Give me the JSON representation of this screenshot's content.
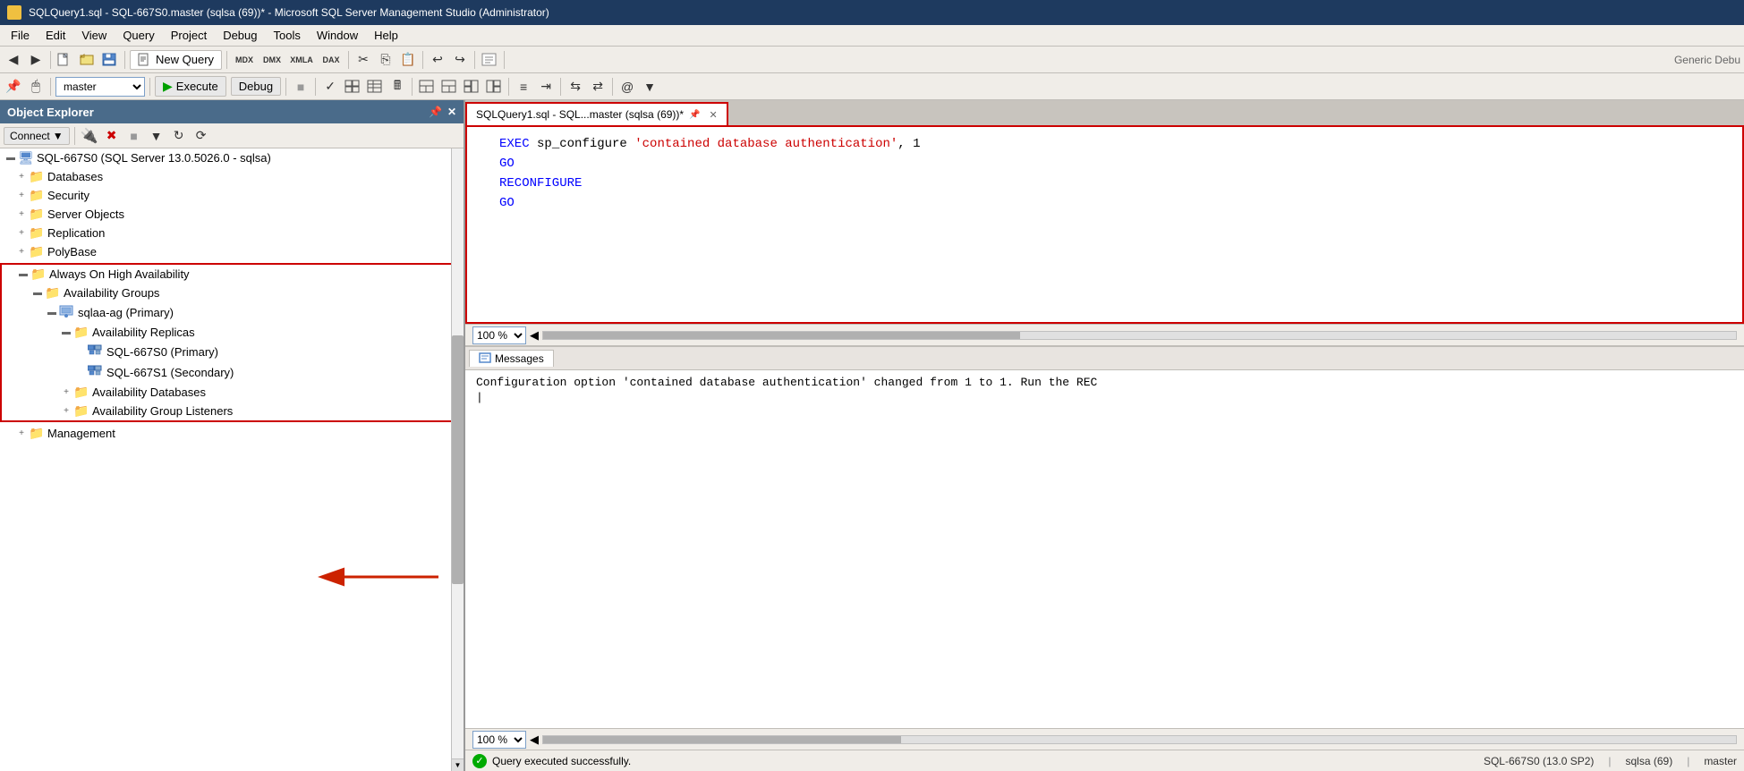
{
  "titleBar": {
    "text": "SQLQuery1.sql - SQL-667S0.master (sqlsa (69))* - Microsoft SQL Server Management Studio (Administrator)"
  },
  "menuBar": {
    "items": [
      "File",
      "Edit",
      "View",
      "Query",
      "Project",
      "Debug",
      "Tools",
      "Window",
      "Help"
    ]
  },
  "toolbar1": {
    "newQueryLabel": "New Query"
  },
  "toolbar2": {
    "dbSelect": "master",
    "executeLabel": "Execute",
    "debugLabel": "Debug"
  },
  "objectExplorer": {
    "title": "Object Explorer",
    "connectLabel": "Connect",
    "tree": {
      "serverNode": "SQL-667S0 (SQL Server 13.0.5026.0 - sqlsa)",
      "items": [
        {
          "label": "Databases",
          "indent": 1,
          "expanded": false
        },
        {
          "label": "Security",
          "indent": 1,
          "expanded": false
        },
        {
          "label": "Server Objects",
          "indent": 1,
          "expanded": false
        },
        {
          "label": "Replication",
          "indent": 1,
          "expanded": false
        },
        {
          "label": "PolyBase",
          "indent": 1,
          "expanded": false
        },
        {
          "label": "Always On High Availability",
          "indent": 1,
          "expanded": true,
          "highlight": true
        },
        {
          "label": "Availability Groups",
          "indent": 2,
          "expanded": true,
          "highlight": true
        },
        {
          "label": "sqlaa-ag (Primary)",
          "indent": 3,
          "expanded": true,
          "highlight": true
        },
        {
          "label": "Availability Replicas",
          "indent": 4,
          "expanded": true,
          "highlight": true
        },
        {
          "label": "SQL-667S0 (Primary)",
          "indent": 5,
          "isReplica": true,
          "highlight": true,
          "arrow": true
        },
        {
          "label": "SQL-667S1 (Secondary)",
          "indent": 5,
          "isReplica": true,
          "highlight": true
        },
        {
          "label": "Availability Databases",
          "indent": 4,
          "expanded": false,
          "highlight": true
        },
        {
          "label": "Availability Group Listeners",
          "indent": 4,
          "expanded": false,
          "highlight": true
        }
      ],
      "bottomItems": [
        {
          "label": "Management",
          "indent": 1,
          "expanded": false
        }
      ]
    }
  },
  "queryEditor": {
    "tabTitle": "SQLQuery1.sql - SQL...master (sqlsa (69))*",
    "code": {
      "line1": "EXEC sp_configure 'contained database authentication', 1",
      "line2": "GO",
      "line3": "RECONFIGURE",
      "line4": "GO"
    },
    "zoom": "100 %"
  },
  "messages": {
    "tabLabel": "Messages",
    "content": "Configuration option 'contained database authentication' changed from 1 to 1.  Run the REC"
  },
  "resultsZoom": "100 %",
  "statusBar": {
    "successText": "Query executed successfully.",
    "server": "SQL-667S0 (13.0 SP2)",
    "user": "sqlsa (69)",
    "db": "master"
  }
}
